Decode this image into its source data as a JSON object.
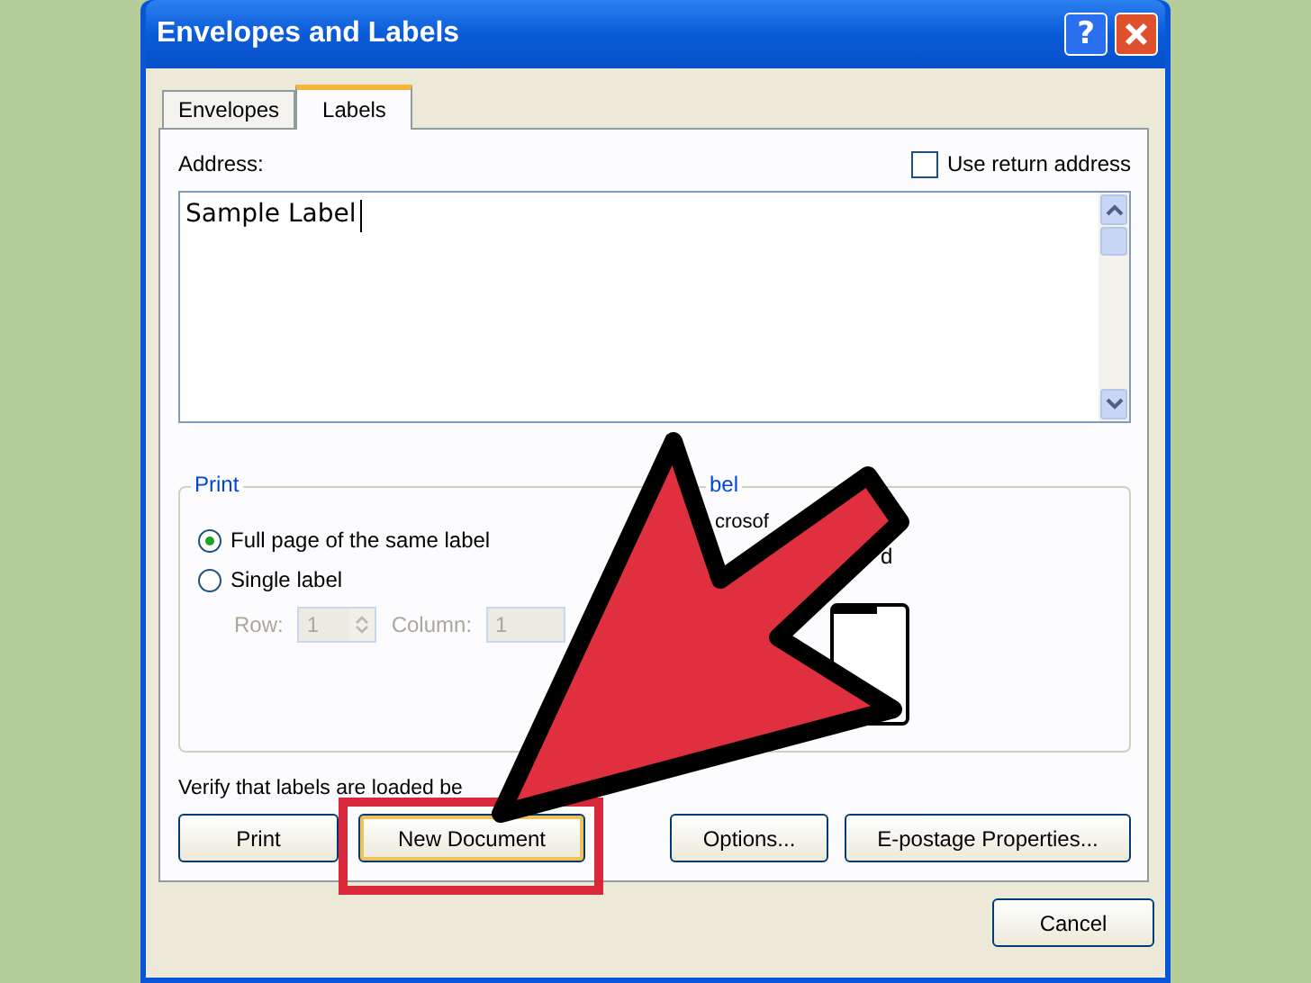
{
  "window": {
    "title": "Envelopes and Labels",
    "help_button": "?"
  },
  "tabs": [
    {
      "label": "Envelopes",
      "selected": false
    },
    {
      "label": "Labels",
      "selected": true
    }
  ],
  "address": {
    "label": "Address:",
    "value": "Sample Label"
  },
  "use_return_address": {
    "label": "Use return address",
    "checked": false
  },
  "print_group": {
    "legend": "Print",
    "options": [
      {
        "label": "Full page of the same label",
        "selected": true
      },
      {
        "label": "Single label",
        "selected": false
      }
    ],
    "row": {
      "label": "Row:",
      "value": "1",
      "disabled": true
    },
    "column": {
      "label": "Column:",
      "value": "1",
      "disabled": true
    }
  },
  "label_group": {
    "legend": "bel",
    "lines": [
      "crosof",
      "d"
    ]
  },
  "verify_text": "Verify that labels are loaded be",
  "buttons": [
    {
      "label": "Print",
      "default": false
    },
    {
      "label": "New Document",
      "default": true
    },
    {
      "label": "Options...",
      "default": false
    },
    {
      "label": "E-postage Properties...",
      "default": false
    }
  ],
  "cancel_button": "Cancel"
}
